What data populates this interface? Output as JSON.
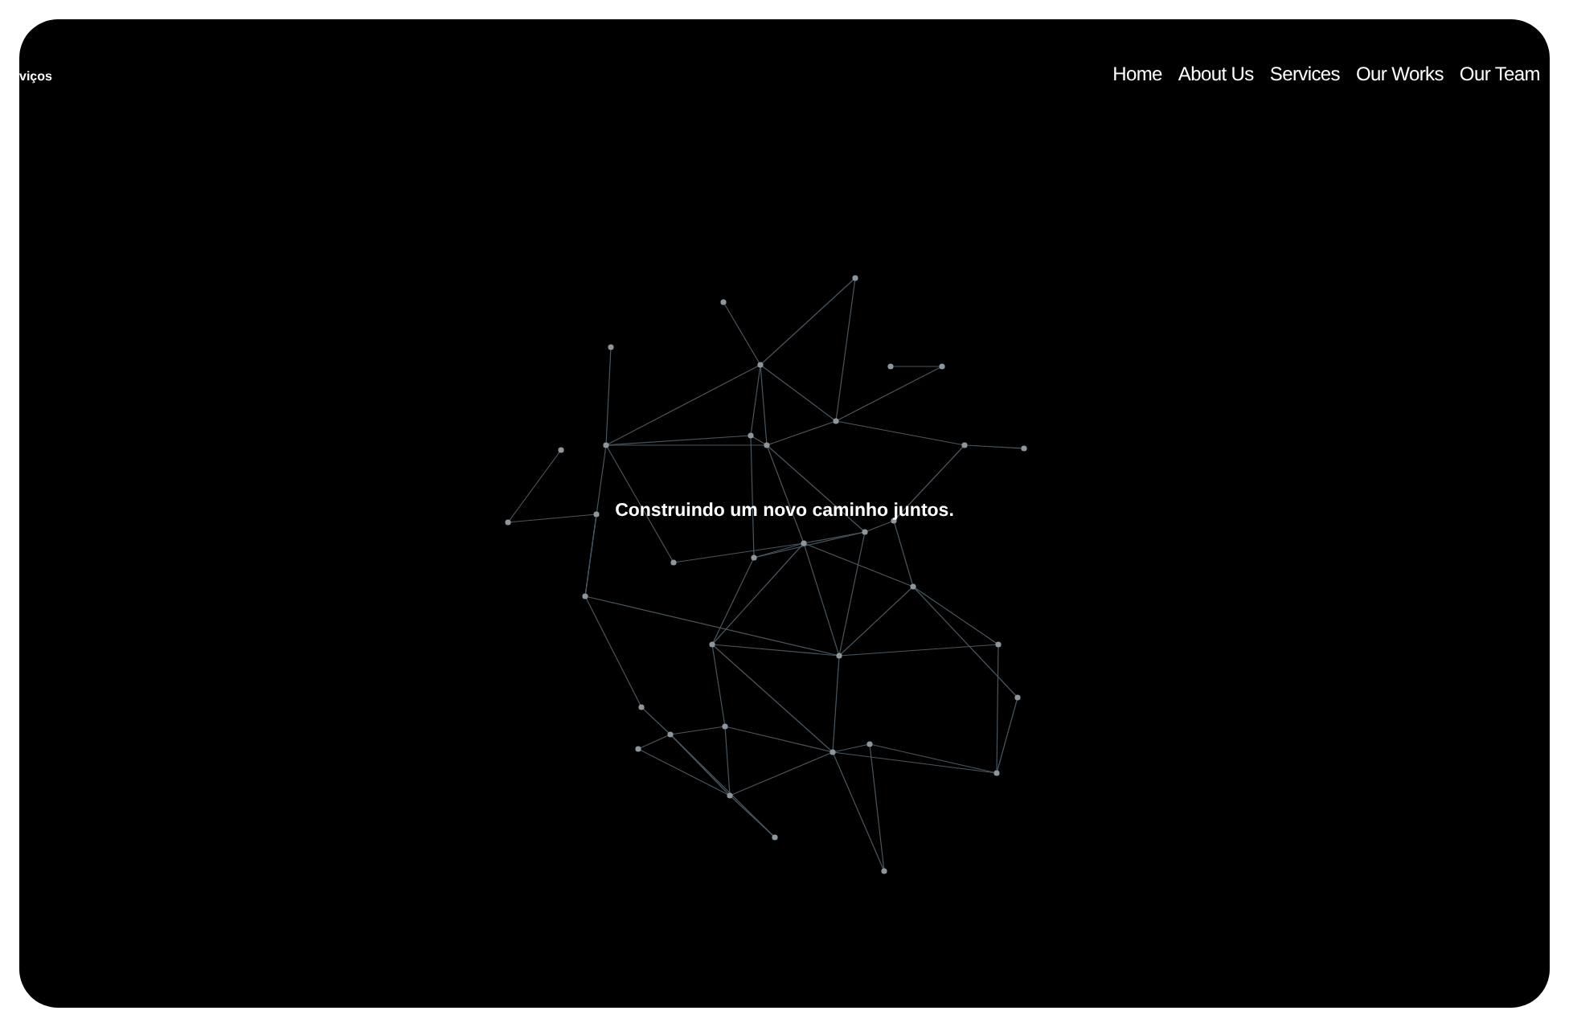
{
  "brand": "viços",
  "nav": [
    {
      "label": "Home"
    },
    {
      "label": "About Us"
    },
    {
      "label": "Services"
    },
    {
      "label": "Our Works"
    },
    {
      "label": "Our Team"
    }
  ],
  "hero": {
    "title": "Construindo um novo caminho juntos."
  }
}
